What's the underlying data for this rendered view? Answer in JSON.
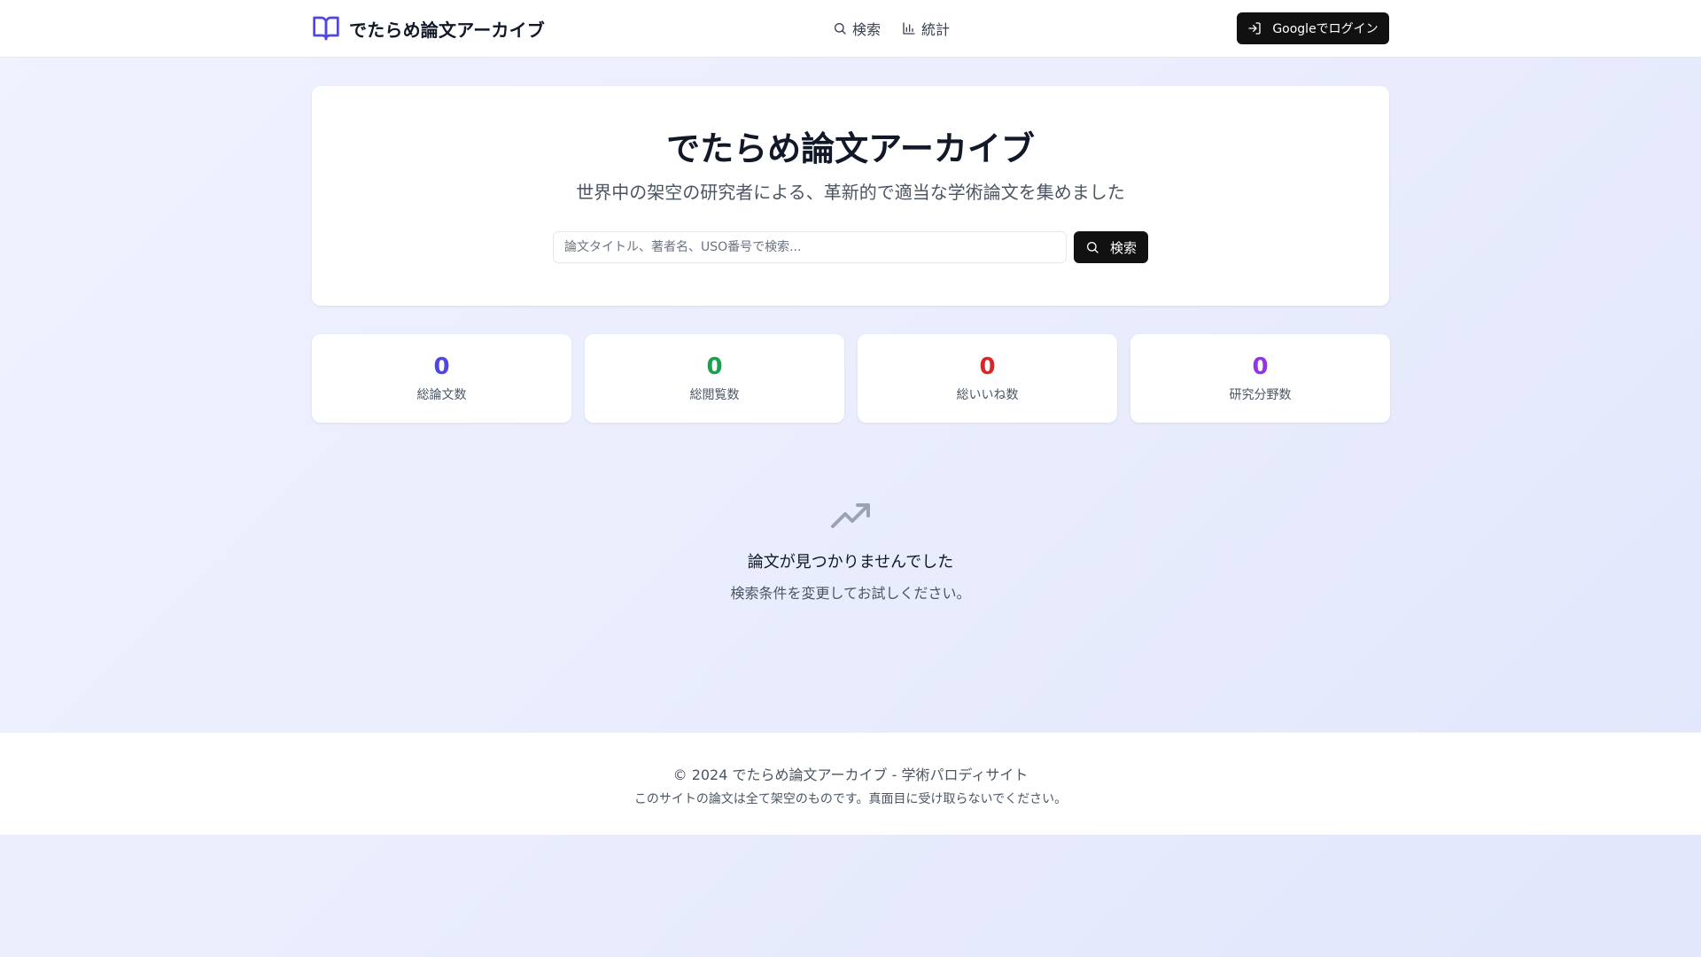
{
  "header": {
    "brand_title": "でたらめ論文アーカイブ",
    "nav": [
      {
        "label": "検索",
        "icon": "search-icon"
      },
      {
        "label": "統計",
        "icon": "bar-chart-icon"
      }
    ],
    "login_label": "Googleでログイン",
    "login_icon": "log-in-icon"
  },
  "hero": {
    "title": "でたらめ論文アーカイブ",
    "subtitle": "世界中の架空の研究者による、革新的で適当な学術論文を集めました",
    "search_placeholder": "論文タイトル、著者名、USO番号で検索...",
    "search_value": "",
    "search_button_label": "検索"
  },
  "stats": [
    {
      "value": "0",
      "label": "総論文数",
      "color": "#4f46e5"
    },
    {
      "value": "0",
      "label": "総閲覧数",
      "color": "#16a34a"
    },
    {
      "value": "0",
      "label": "総いいね数",
      "color": "#dc2626"
    },
    {
      "value": "0",
      "label": "研究分野数",
      "color": "#9333ea"
    }
  ],
  "empty_state": {
    "icon": "trending-up-icon",
    "title": "論文が見つかりませんでした",
    "description": "検索条件を変更してお試しください。"
  },
  "footer": {
    "copyright": "© 2024 でたらめ論文アーカイブ - 学術パロディサイト",
    "note": "このサイトの論文は全て架空のものです。真面目に受け取らないでください。"
  },
  "colors": {
    "brand_accent": "#4f46e5",
    "button_bg": "#111111"
  }
}
